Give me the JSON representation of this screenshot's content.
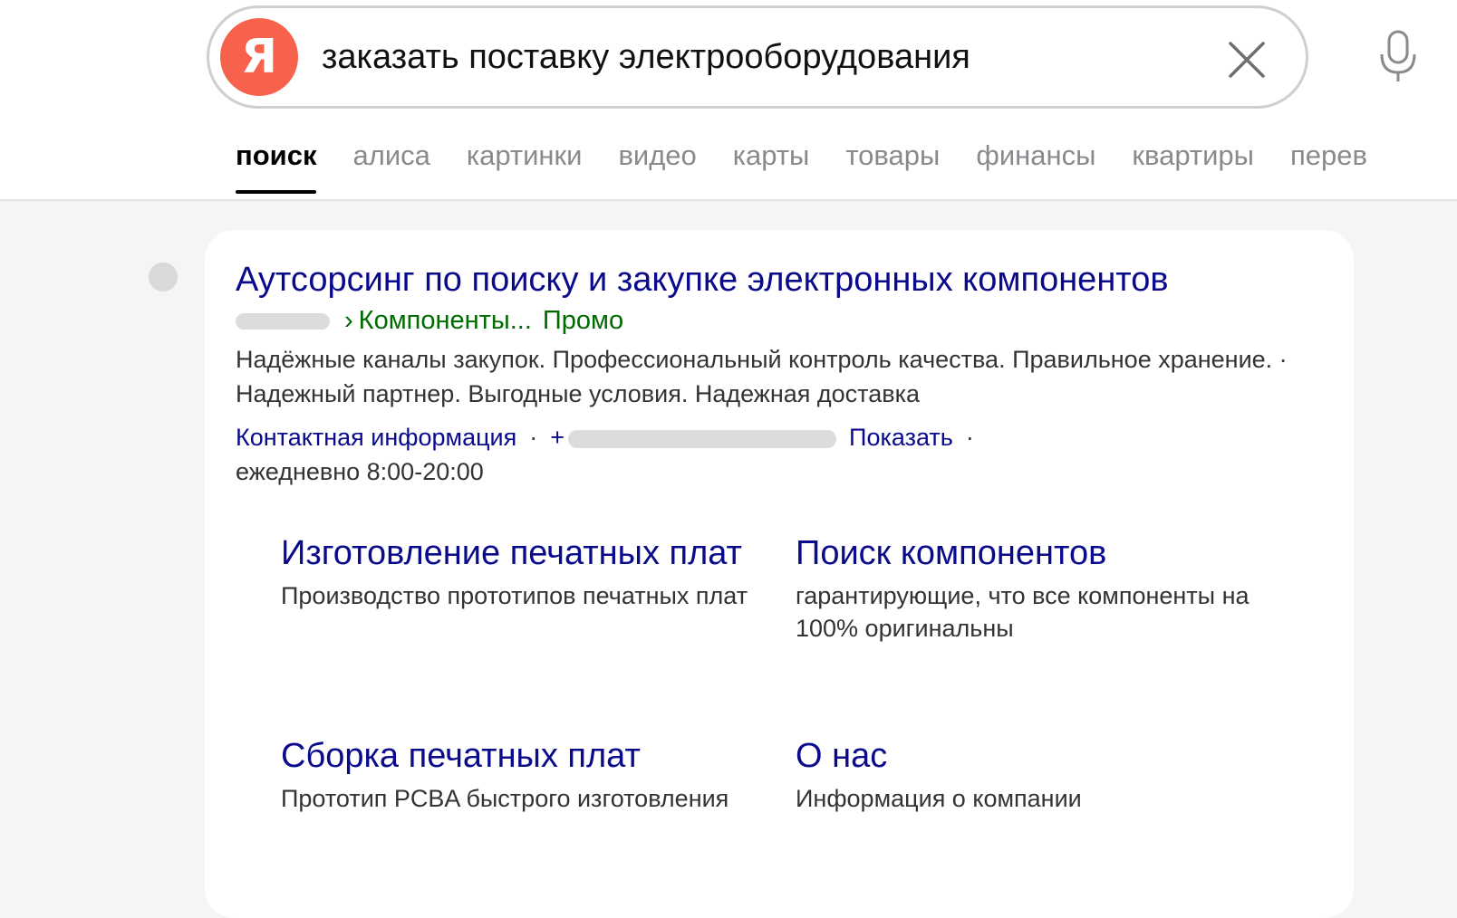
{
  "search": {
    "logo_letter": "Я",
    "query": "заказать поставку электрооборудования"
  },
  "tabs": [
    {
      "label": "поиск",
      "active": true
    },
    {
      "label": "алиса"
    },
    {
      "label": "картинки"
    },
    {
      "label": "видео"
    },
    {
      "label": "карты"
    },
    {
      "label": "товары"
    },
    {
      "label": "финансы"
    },
    {
      "label": "квартиры"
    },
    {
      "label": "перев"
    }
  ],
  "result": {
    "title": "Аутсорсинг по поиску и закупке электронных компонентов",
    "breadcrumb_arrow": "›",
    "breadcrumb": "Компоненты...",
    "promo_label": "Промо",
    "snippet": "Надёжные каналы закупок. Профессиональный контроль качества. Правильное хранение. · Надежный партнер. Выгодные условия. Надежная доставка",
    "contact_link": "Контактная информация",
    "separator": "·",
    "phone_prefix": "+",
    "show_link": "Показать",
    "hours": "ежедневно 8:00-20:00",
    "sitelinks": [
      {
        "title": "Изготовление печатных плат",
        "desc": "Производство прототипов печатных плат"
      },
      {
        "title": "Поиск компонентов",
        "desc": "гарантирующие, что все компоненты на 100% оригинальны"
      },
      {
        "title": "Сборка печатных плат",
        "desc": "Прототип PCBA быстрого изготовления"
      },
      {
        "title": "О нас",
        "desc": "Информация о компании"
      }
    ]
  },
  "colors": {
    "logo": "#f7624c",
    "link": "#0a0a8c",
    "url_green": "#006b00"
  },
  "icons": {
    "clear": "close-icon",
    "voice": "microphone-icon"
  }
}
